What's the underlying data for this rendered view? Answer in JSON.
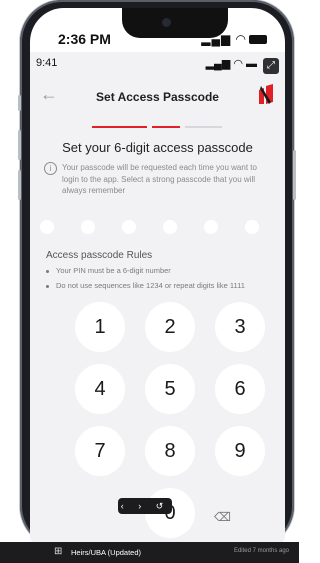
{
  "device": {
    "outer_time": "2:36 PM",
    "outer_icons": "▂▄▆ ◠",
    "inner_time": "9:41",
    "inner_icons": "▂▄▆ ◠ ▬"
  },
  "header": {
    "back_icon": "back-arrow-icon",
    "title": "Set Access Passcode",
    "brand_color": "#e01f26"
  },
  "progress": {
    "completed_color": "#e01f26",
    "steps_filled": 2,
    "steps_total": 3
  },
  "content": {
    "heading": "Set your 6-digit access passcode",
    "info_text": "Your passcode will be requested each time you want to login to the app. Select a strong passcode that you will always remember",
    "pin_length": 6,
    "rules_title": "Access passcode Rules",
    "rules": [
      "Your PIN must be a 6-digit number",
      "Do not use sequences like 1234 or repeat digits like 1111"
    ]
  },
  "keypad": {
    "keys": [
      "1",
      "2",
      "3",
      "4",
      "5",
      "6",
      "7",
      "8",
      "9",
      "0"
    ],
    "backspace_icon": "⌫"
  },
  "nav_pill": "‹ › ↺",
  "bottom_bar": {
    "file_name": "Heirs/UBA (Updated)",
    "edited": "Edited 7 months ago"
  }
}
